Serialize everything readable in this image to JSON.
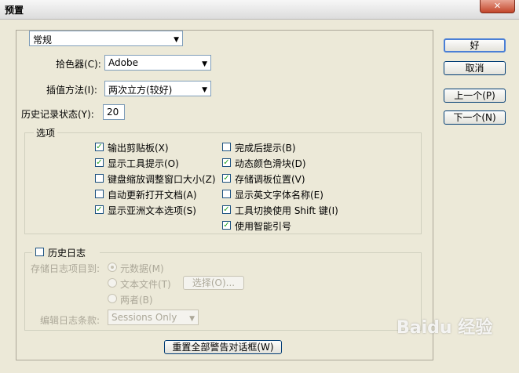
{
  "window": {
    "title": "预置",
    "close_glyph": "✕"
  },
  "header": {
    "category": "常规"
  },
  "fields": {
    "color_picker_label": "拾色器(C):",
    "color_picker_value": "Adobe",
    "interp_label": "插值方法(I):",
    "interp_value": "两次立方(较好)",
    "history_label": "历史记录状态(Y):",
    "history_value": "20"
  },
  "options": {
    "legend": "选项",
    "left": [
      {
        "label": "输出剪贴板(X)",
        "checked": true
      },
      {
        "label": "显示工具提示(O)",
        "checked": true
      },
      {
        "label": "键盘缩放调整窗口大小(Z)",
        "checked": false
      },
      {
        "label": "自动更新打开文档(A)",
        "checked": false
      },
      {
        "label": "显示亚洲文本选项(S)",
        "checked": true
      }
    ],
    "right": [
      {
        "label": "完成后提示(B)",
        "checked": false
      },
      {
        "label": "动态颜色滑块(D)",
        "checked": true
      },
      {
        "label": "存储调板位置(V)",
        "checked": true
      },
      {
        "label": "显示英文字体名称(E)",
        "checked": false
      },
      {
        "label": "工具切换使用 Shift 键(I)",
        "checked": true
      },
      {
        "label": "使用智能引号",
        "checked": true
      }
    ]
  },
  "history_log": {
    "legend": "历史日志",
    "save_to_label": "存储日志项目到:",
    "radio_metadata": "元数据(M)",
    "radio_textfile": "文本文件(T)",
    "radio_both": "两者(B)",
    "choose_button": "选择(O)...",
    "edit_label": "编辑日志条款:",
    "edit_value": "Sessions Only"
  },
  "reset_button": "重置全部警告对话框(W)",
  "buttons": {
    "ok": "好",
    "cancel": "取消",
    "prev": "上一个(P)",
    "next": "下一个(N)"
  },
  "watermark": "Baidu 经验"
}
